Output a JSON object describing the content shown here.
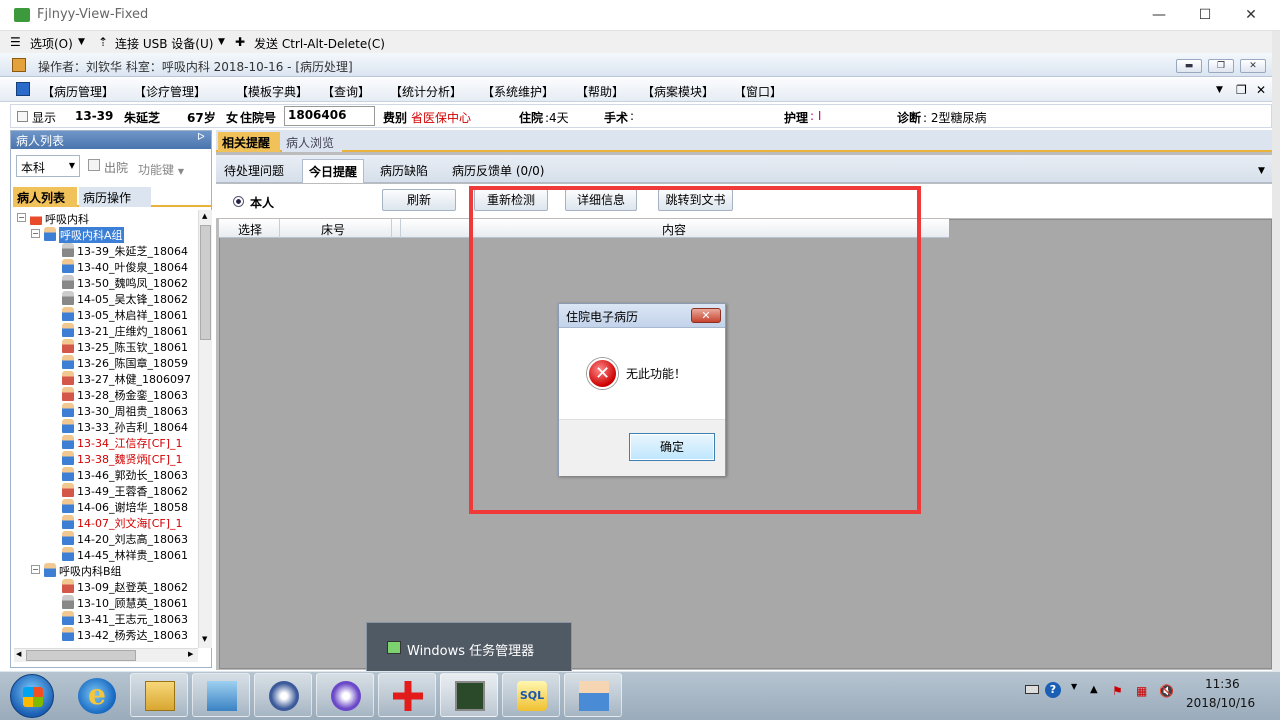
{
  "window": {
    "title": "Fjlnyy-View-Fixed",
    "minimize": "—",
    "maximize": "☐",
    "close": "✕"
  },
  "viewer": {
    "options": "选项(O)",
    "usb": "连接 USB 设备(U)",
    "cad": "发送 Ctrl-Alt-Delete(C)"
  },
  "operator_bar": {
    "text": "操作者：刘钦华  科室：呼吸内科  2018-10-16 - [病历处理]"
  },
  "menu": {
    "items": [
      "【病历管理】",
      "【诊疗管理】",
      "【模板字典】",
      "【查询】",
      "【统计分析】",
      "【系统维护】",
      "【帮助】",
      "【病案模块】",
      "【窗口】"
    ]
  },
  "patient_info": {
    "show_label": "显示",
    "bed": "13-39",
    "name": "朱延芝",
    "age": "67岁",
    "gender_label": "女",
    "admission_label": "住院号",
    "admission_no": "1806406",
    "fee_label": "费别",
    "fee_value": "省医保中心",
    "stay_label": "住院",
    "stay_value": ":4天",
    "surgery_label": "手术",
    "surgery_value": ":",
    "nursing_label": "护理",
    "nursing_value": ": I",
    "diagnosis_label": "诊断",
    "diagnosis_value": ": 2型糖尿病"
  },
  "left_panel": {
    "header": "病人列表",
    "pin": "ᐅ",
    "dept_combo": "本科",
    "discharge": "出院",
    "func_key": "功能键",
    "tabs": [
      "病人列表",
      "病历操作"
    ],
    "tree": [
      {
        "label": "呼吸内科",
        "level": 0,
        "type": "dept"
      },
      {
        "label": "呼吸内科A组",
        "level": 1,
        "type": "group",
        "selected": true
      },
      {
        "label": "13-39_朱延芝_18064",
        "level": 2,
        "type": "g"
      },
      {
        "label": "13-40_叶俊泉_18064",
        "level": 2,
        "type": "m"
      },
      {
        "label": "13-50_魏鸣凤_18062",
        "level": 2,
        "type": "g"
      },
      {
        "label": "14-05_吴太锋_18062",
        "level": 2,
        "type": "g"
      },
      {
        "label": "13-05_林启祥_18061",
        "level": 2,
        "type": "m"
      },
      {
        "label": "13-21_庄维灼_18061",
        "level": 2,
        "type": "m"
      },
      {
        "label": "13-25_陈玉钦_18061",
        "level": 2,
        "type": "f"
      },
      {
        "label": "13-26_陈国章_18059",
        "level": 2,
        "type": "m"
      },
      {
        "label": "13-27_林健_1806097",
        "level": 2,
        "type": "f"
      },
      {
        "label": "13-28_杨金銮_18063",
        "level": 2,
        "type": "f"
      },
      {
        "label": "13-30_周祖贵_18063",
        "level": 2,
        "type": "m"
      },
      {
        "label": "13-33_孙吉利_18064",
        "level": 2,
        "type": "m"
      },
      {
        "label": "13-34_江信存[CF]_1",
        "level": 2,
        "type": "m",
        "red": true
      },
      {
        "label": "13-38_魏贤炳[CF]_1",
        "level": 2,
        "type": "m",
        "red": true
      },
      {
        "label": "13-46_郭劲长_18063",
        "level": 2,
        "type": "m"
      },
      {
        "label": "13-49_王蓉香_18062",
        "level": 2,
        "type": "f"
      },
      {
        "label": "14-06_谢培华_18058",
        "level": 2,
        "type": "m"
      },
      {
        "label": "14-07_刘文海[CF]_1",
        "level": 2,
        "type": "m",
        "red": true
      },
      {
        "label": "14-20_刘志高_18063",
        "level": 2,
        "type": "m"
      },
      {
        "label": "14-45_林祥贵_18061",
        "level": 2,
        "type": "m"
      },
      {
        "label": "呼吸内科B组",
        "level": 1,
        "type": "group"
      },
      {
        "label": "13-09_赵登英_18062",
        "level": 2,
        "type": "f"
      },
      {
        "label": "13-10_顾慧英_18061",
        "level": 2,
        "type": "g"
      },
      {
        "label": "13-41_王志元_18063",
        "level": 2,
        "type": "m"
      },
      {
        "label": "13-42_杨秀达_18063",
        "level": 2,
        "type": "m"
      }
    ]
  },
  "right_panel": {
    "tabs": [
      "相关提醒",
      "病人浏览"
    ],
    "subtabs": [
      "待处理问题",
      "今日提醒",
      "病历缺陷",
      "病历反馈单 (0/0)"
    ],
    "radio_label": "本人",
    "buttons": [
      "刷新",
      "重新检测",
      "详细信息",
      "跳转到文书"
    ],
    "columns": [
      "选择",
      "床号",
      "内容"
    ]
  },
  "dialog": {
    "title": "住院电子病历",
    "message": "无此功能！",
    "ok": "确定",
    "close": "✕"
  },
  "popup": {
    "label": "Windows 任务管理器"
  },
  "taskbar": {
    "time": "11:36",
    "date": "2018/10/16"
  },
  "colors": {
    "highlight_box": "#f03a3a",
    "tab_accent": "#e8b23c",
    "fee_text": "#d40000",
    "nursing_text": "#c00080"
  }
}
